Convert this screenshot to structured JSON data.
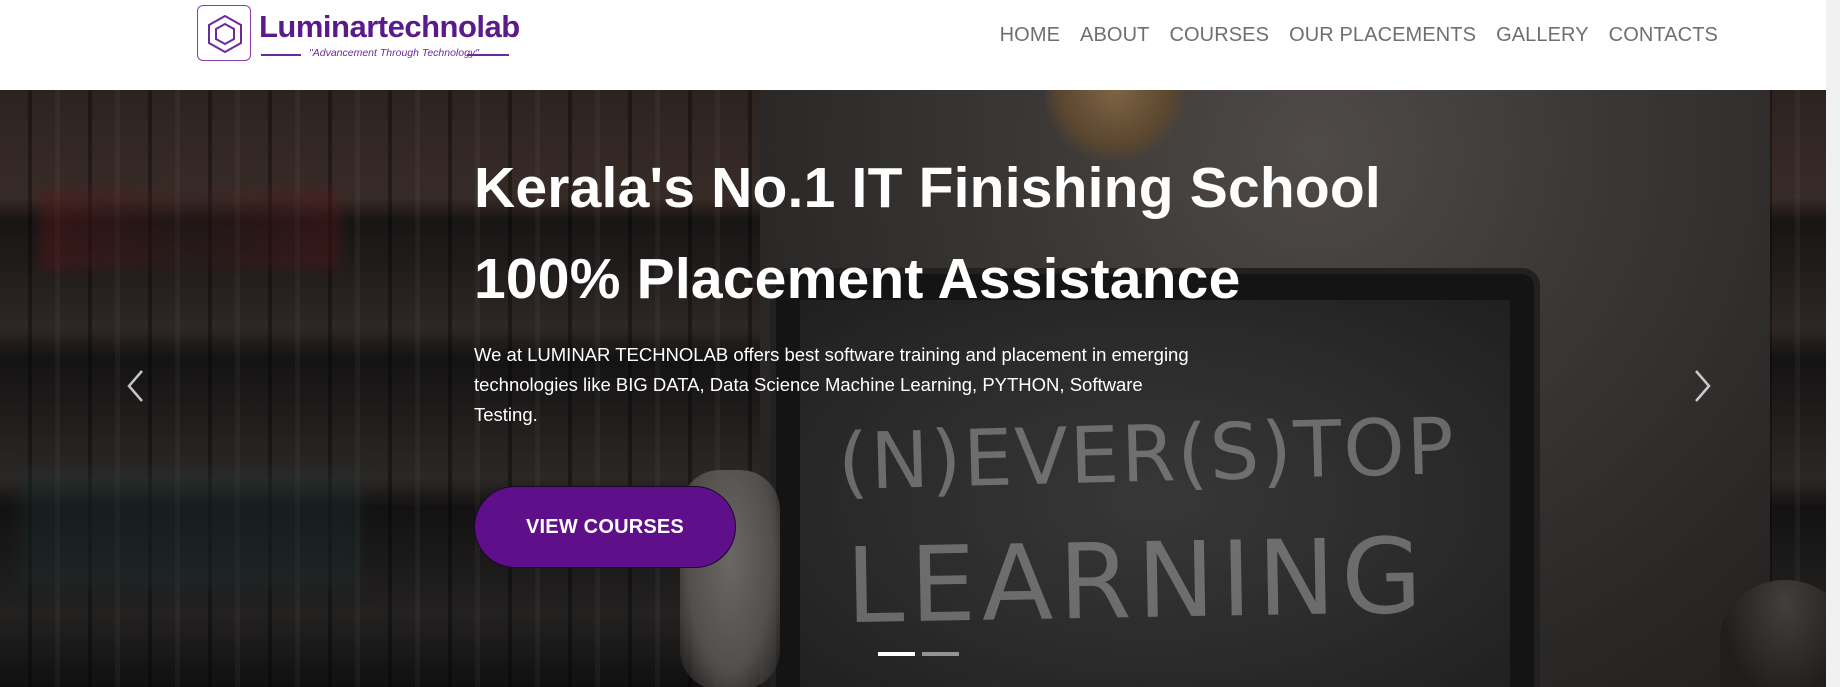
{
  "brand": {
    "name": "Luminartechnolab",
    "tagline": "\"Advancement Through Technology\"",
    "icon": "hexagon-logo-icon",
    "color": "#5b1a8c"
  },
  "nav": {
    "items": [
      {
        "label": "HOME"
      },
      {
        "label": "ABOUT"
      },
      {
        "label": "COURSES"
      },
      {
        "label": "OUR PLACEMENTS"
      },
      {
        "label": "GALLERY"
      },
      {
        "label": "CONTACTS"
      }
    ]
  },
  "hero": {
    "headline_1": "Kerala's No.1 IT Finishing School",
    "headline_2": "100% Placement Assistance",
    "description": "We at LUMINAR TECHNOLAB offers best software training and placement in emerging technologies like BIG DATA, Data Science Machine Learning, PYTHON, Software Testing.",
    "cta_label": "VIEW COURSES",
    "cta_color": "#5f0f8a",
    "image_text_1": "(N)EVER(S)TOP",
    "image_text_2": "LEARNING",
    "prev_icon": "chevron-left-icon",
    "next_icon": "chevron-right-icon",
    "slides": 2,
    "active_slide": 1
  }
}
